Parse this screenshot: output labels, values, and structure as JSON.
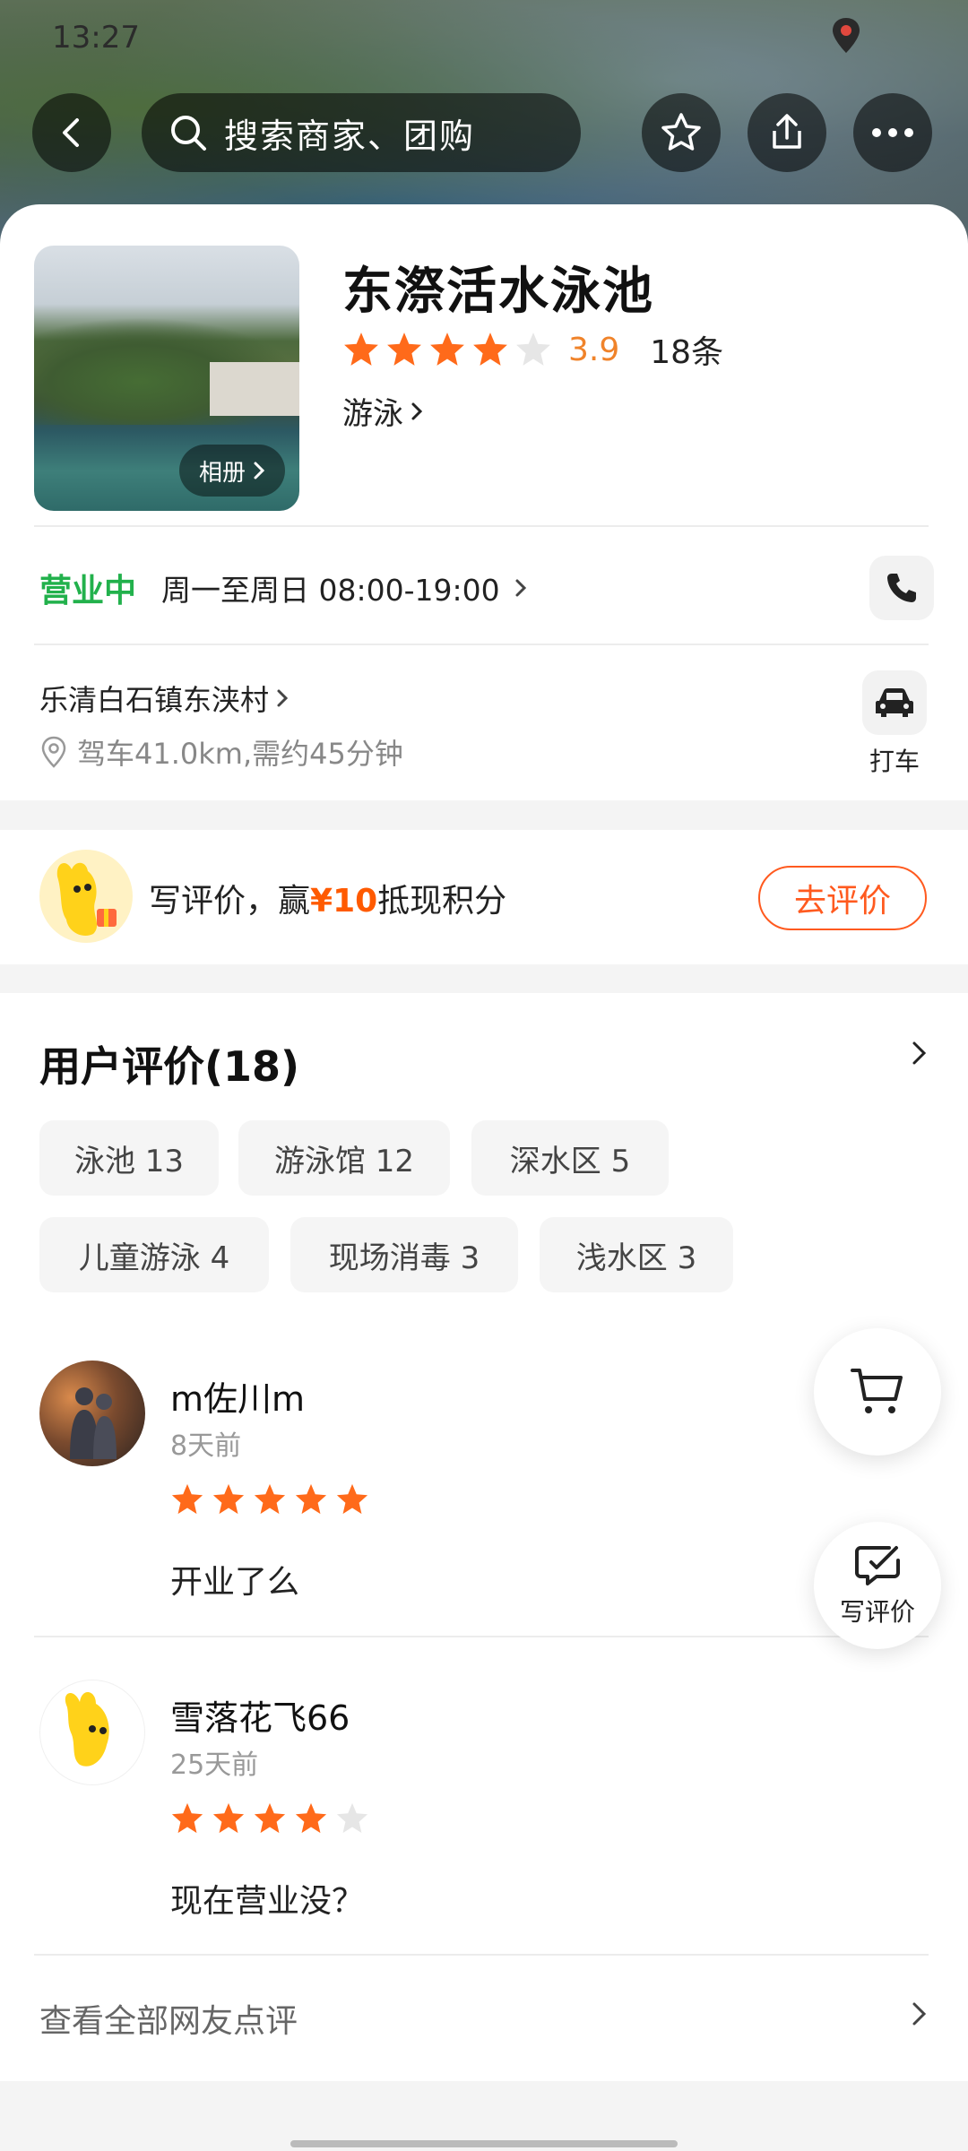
{
  "status_bar": {
    "time": "13:27"
  },
  "topbar": {
    "search_placeholder": "搜索商家、团购",
    "icons": [
      "back-icon",
      "search-icon",
      "star-outline-icon",
      "share-icon",
      "more-icon"
    ]
  },
  "shop": {
    "album_label": "相册",
    "name": "东漈活水泳池",
    "rating": "3.9",
    "rating_stars": 4,
    "review_count": "18条",
    "category": "游泳",
    "open_status": "营业中",
    "hours": "周一至周日 08:00-19:00",
    "address": "乐清白石镇东浃村",
    "distance": "驾车41.0km,需约45分钟",
    "taxi_label": "打车"
  },
  "promo": {
    "text_before": "写评价，赢",
    "highlight": "¥10",
    "text_after": "抵现积分",
    "button": "去评价"
  },
  "reviews": {
    "title": "用户评价(18)",
    "tags": [
      "泳池 13",
      "游泳馆 12",
      "深水区 5",
      "儿童游泳 4",
      "现场消毒 3",
      "浅水区 3"
    ],
    "items": [
      {
        "name": "m佐川m",
        "time": "8天前",
        "stars": 5,
        "text": "开业了么"
      },
      {
        "name": "雪落花飞66",
        "time": "25天前",
        "stars": 4,
        "text": "现在营业没？"
      }
    ],
    "see_all": "查看全部网友点评"
  },
  "fab": {
    "write_review": "写评价"
  },
  "colors": {
    "accent": "#ff5a1f",
    "open": "#22b14c",
    "star": "#ff6a1a",
    "rating": "#f0832a"
  }
}
